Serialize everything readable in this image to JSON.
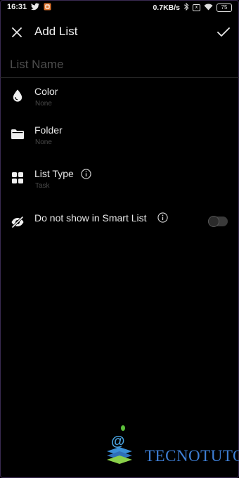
{
  "status_bar": {
    "time": "16:31",
    "speed": "0.7KB/s",
    "battery": "75",
    "sim_box": "x"
  },
  "app_bar": {
    "title": "Add List"
  },
  "list_name": {
    "placeholder": "List Name",
    "value": ""
  },
  "options": {
    "color": {
      "label": "Color",
      "value": "None"
    },
    "folder": {
      "label": "Folder",
      "value": "None"
    },
    "list_type": {
      "label": "List Type",
      "value": "Task"
    },
    "smart_list": {
      "label": "Do not show in Smart List",
      "enabled": false
    }
  },
  "watermark": {
    "text": "TECNOTUTO"
  },
  "colors": {
    "background": "#000000",
    "text": "#e8e8e8",
    "muted": "#4a4a4a",
    "watermark": "#3e7fd6"
  }
}
